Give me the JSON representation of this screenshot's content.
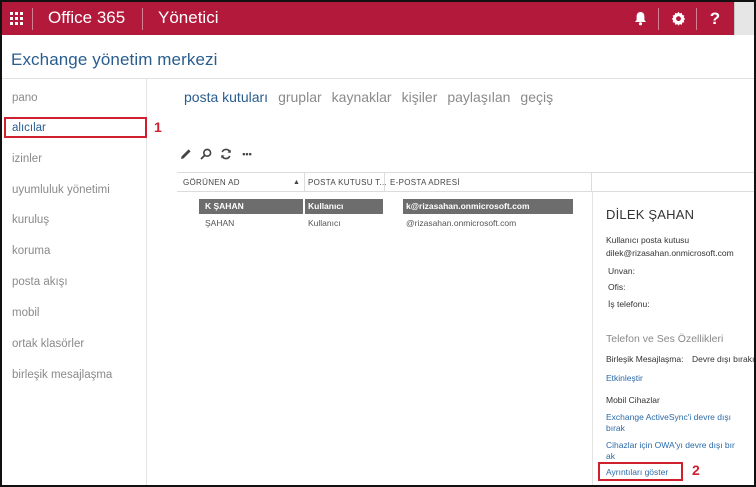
{
  "topbar": {
    "app_title": "Office 365",
    "section_title": "Yönetici",
    "icons": [
      "waffle-icon",
      "bell-icon",
      "gear-icon",
      "help-icon"
    ],
    "help_label": "?",
    "color": "#b3193b"
  },
  "page": {
    "title": "Exchange yönetim merkezi"
  },
  "nav": {
    "items": [
      "pano",
      "alıcılar",
      "izinler",
      "uyumluluk yönetimi",
      "kuruluş",
      "koruma",
      "posta akışı",
      "mobil",
      "ortak klasörler",
      "birleşik mesajlaşma"
    ],
    "active": "alıcılar"
  },
  "callouts": {
    "one": "1",
    "two": "2",
    "color": "#d0202e"
  },
  "tabs": {
    "items": [
      "posta kutuları",
      "gruplar",
      "kaynaklar",
      "kişiler",
      "paylaşılan",
      "geçiş"
    ],
    "active": "posta kutuları"
  },
  "toolbar": {
    "icons": [
      "edit-icon",
      "search-icon",
      "refresh-icon",
      "more-icon"
    ],
    "more_label": "•••"
  },
  "table": {
    "headers": [
      "GÖRÜNEN AD",
      "POSTA KUTUSU T...",
      "E-POSTA ADRESİ"
    ],
    "rows": [
      {
        "name": "K ŞAHAN",
        "type": "Kullanıcı",
        "email": "k@rizasahan.onmicrosoft.com",
        "selected": true
      },
      {
        "name": "ŞAHAN",
        "type": "Kullanıcı",
        "email": "@rizasahan.onmicrosoft.com",
        "selected": false
      }
    ]
  },
  "details": {
    "name": "DİLEK ŞAHAN",
    "mailbox_type": "Kullanıcı posta kutusu",
    "email": "dilek@rizasahan.onmicrosoft.com",
    "title_label": "Unvan:",
    "office_label": "Ofis:",
    "phone_label": "İş telefonu:",
    "phone_section": "Telefon ve Ses Özellikleri",
    "um_label": "Birleşik Mesajlaşma:",
    "um_value": "Devre dışı bırakı",
    "enable_link": "Etkinleştir",
    "mobile_section": "Mobil Cihazlar",
    "eas_link": "Exchange ActiveSync'i devre dışı bırak",
    "owa_link": "Cihazlar için OWA'yı devre dışı bır ak",
    "show_details": "Ayrıntıları göster"
  }
}
